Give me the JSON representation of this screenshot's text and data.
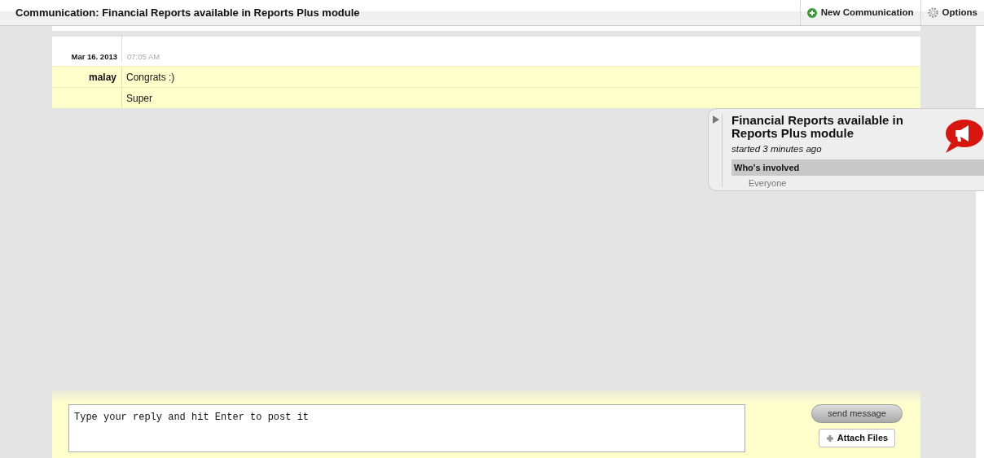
{
  "header": {
    "title": "Communication: Financial Reports available in Reports Plus module",
    "actions": [
      {
        "kind": "add",
        "label": "New Communication"
      },
      {
        "kind": "settings",
        "label": "Options"
      }
    ]
  },
  "thread": {
    "date": "Mar 16. 2013",
    "time": "07:05 AM",
    "messages": [
      {
        "author": "malay",
        "text": "Congrats :)"
      },
      {
        "text": "Super"
      }
    ]
  },
  "info_panel": {
    "expanded": false,
    "title": "Financial Reports available in Reports Plus module",
    "subtitle": "started 3 minutes ago",
    "section": "Who's involved",
    "members": [
      "Everyone"
    ]
  },
  "composer": {
    "placeholder": "Type your reply and hit Enter to post it",
    "send": "send message",
    "attach": "Attach Files"
  }
}
